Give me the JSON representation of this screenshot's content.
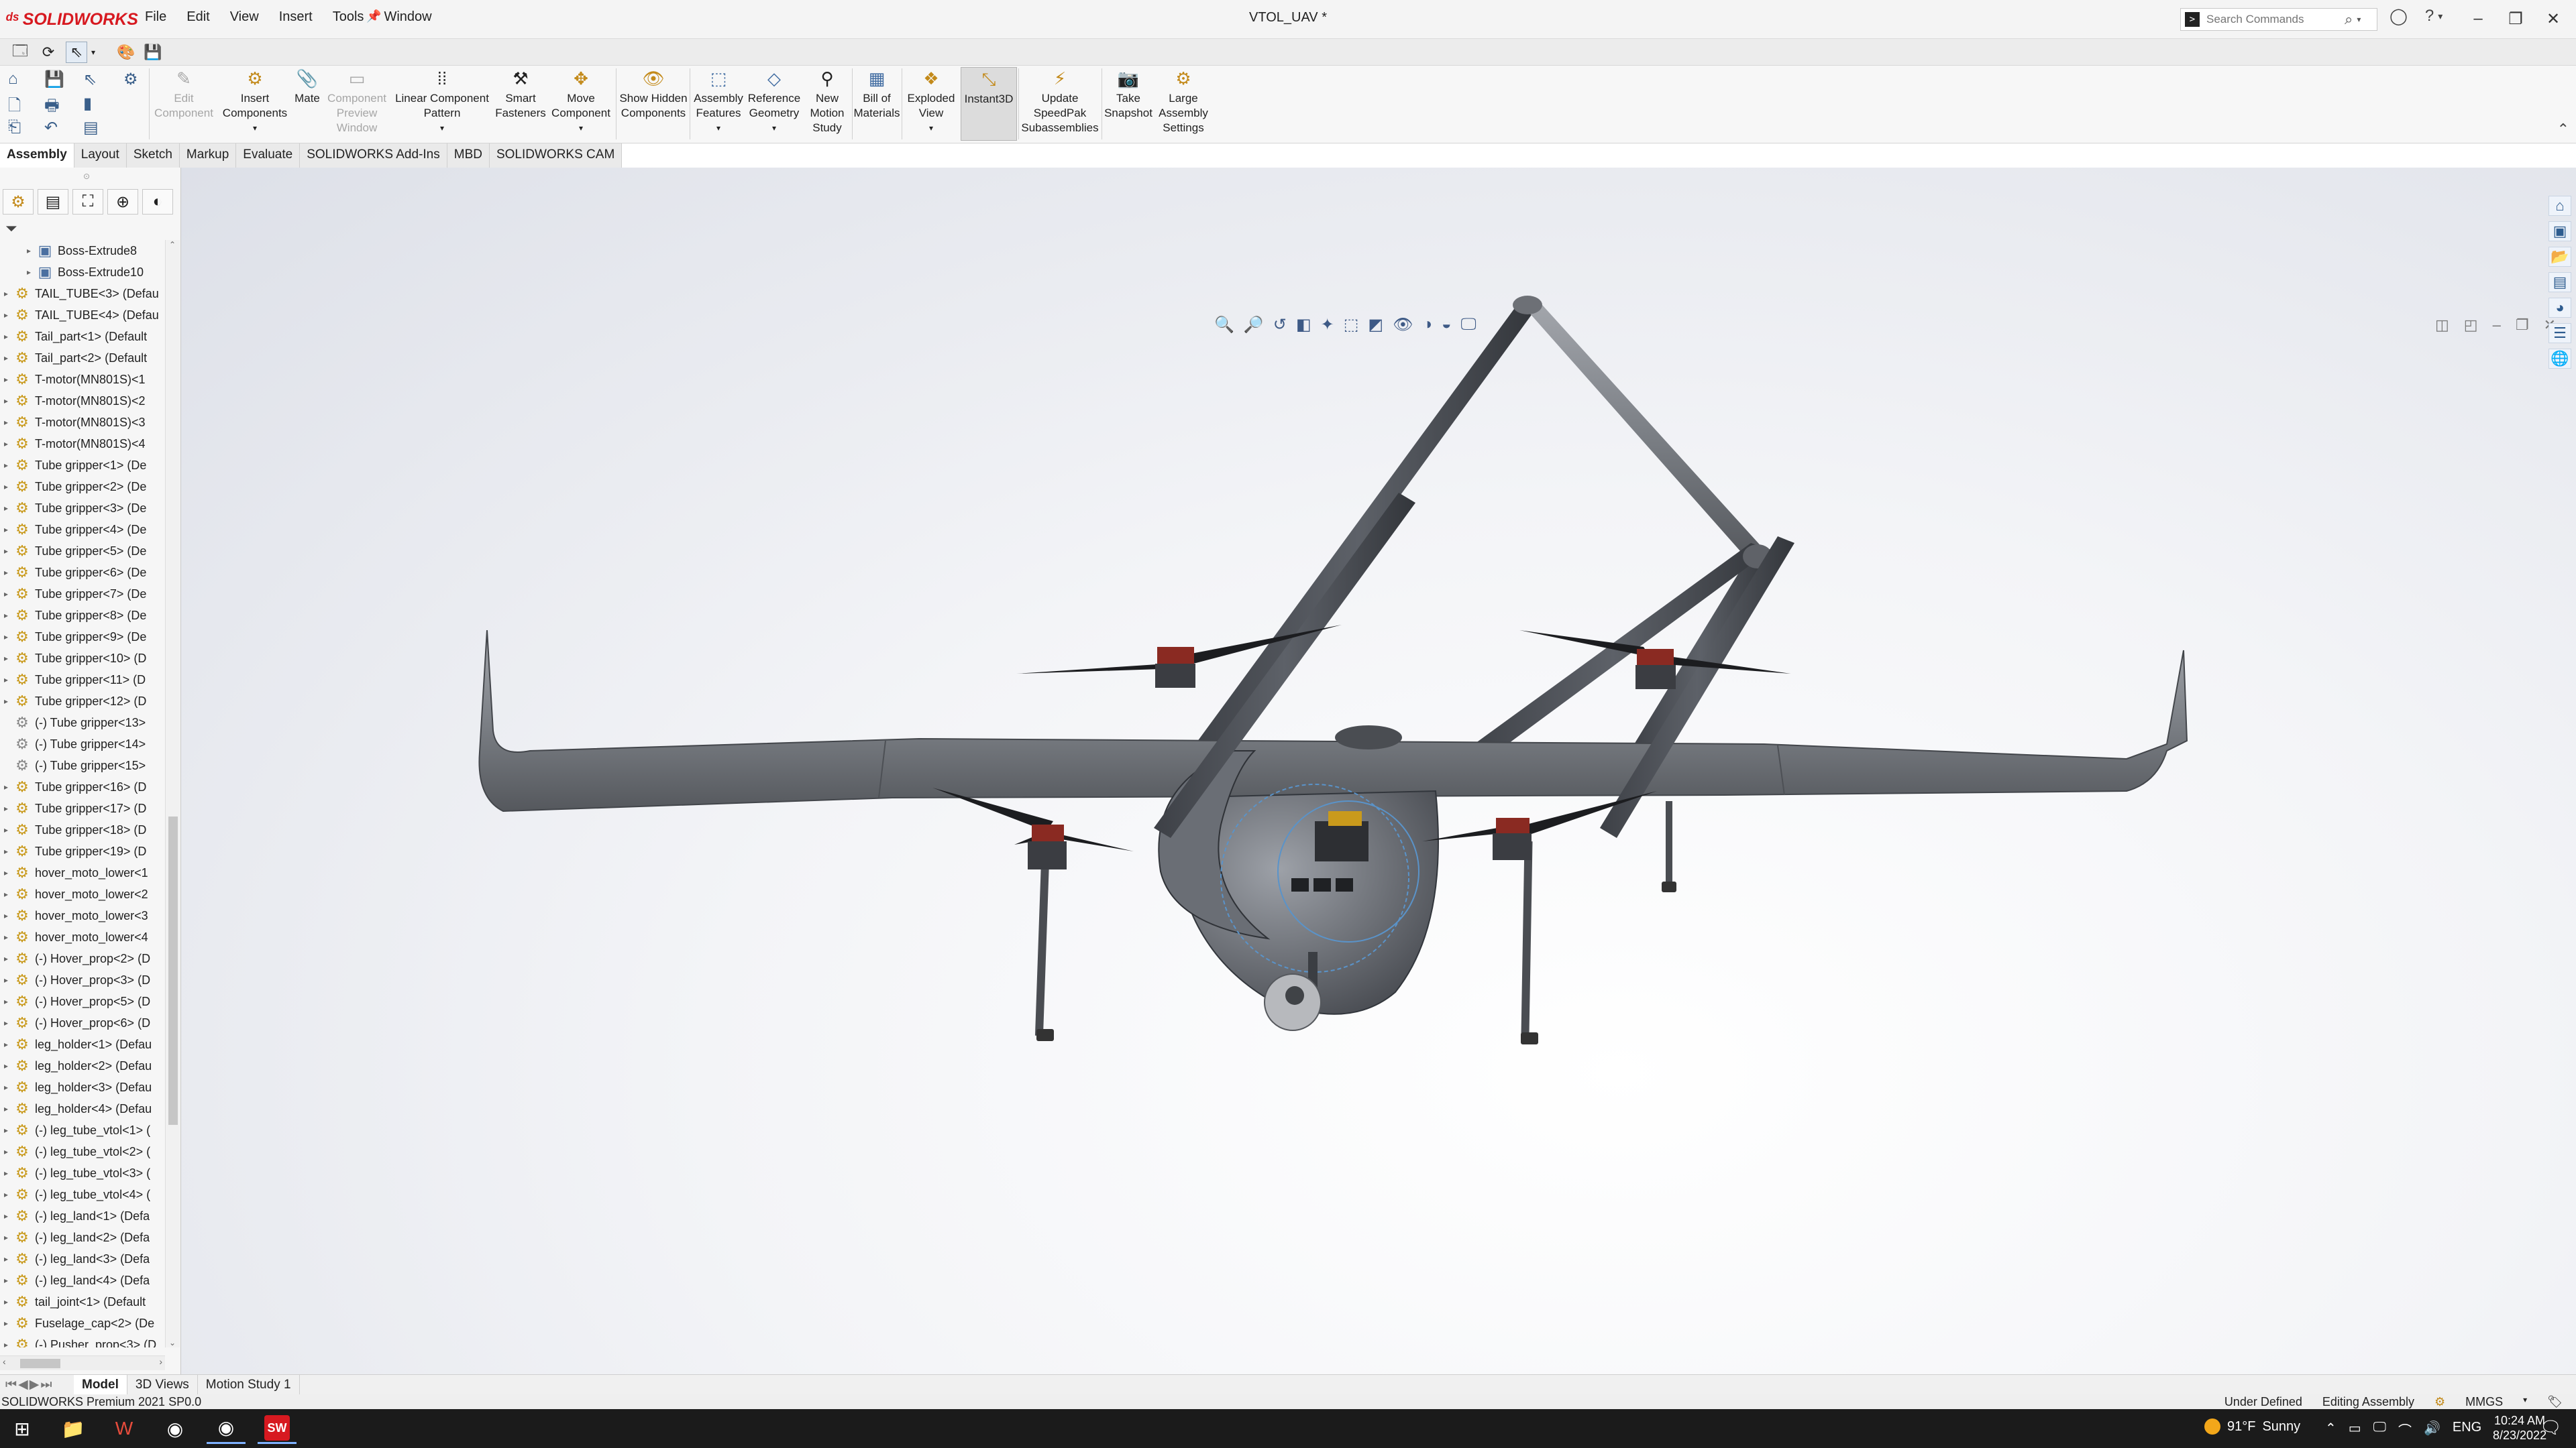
{
  "app": {
    "brand": "SOLIDWORKS",
    "document_title": "VTOL_UAV *",
    "menu": [
      "File",
      "Edit",
      "View",
      "Insert",
      "Tools",
      "Window"
    ],
    "search_placeholder": "Search Commands"
  },
  "ribbon": {
    "commands": [
      {
        "label": "Edit Component",
        "icon": "edit-component-icon",
        "enabled": false
      },
      {
        "label": "Insert Components",
        "icon": "insert-components-icon",
        "enabled": true
      },
      {
        "label": "Mate",
        "icon": "mate-icon",
        "enabled": true
      },
      {
        "label": "Component Preview Window",
        "icon": "preview-window-icon",
        "enabled": false
      },
      {
        "label": "Linear Component Pattern",
        "icon": "linear-pattern-icon",
        "enabled": true
      },
      {
        "label": "Smart Fasteners",
        "icon": "smart-fasteners-icon",
        "enabled": true
      },
      {
        "label": "Move Component",
        "icon": "move-component-icon",
        "enabled": true
      },
      {
        "label": "Show Hidden Components",
        "icon": "show-hidden-icon",
        "enabled": true
      },
      {
        "label": "Assembly Features",
        "icon": "assembly-features-icon",
        "enabled": true
      },
      {
        "label": "Reference Geometry",
        "icon": "reference-geometry-icon",
        "enabled": true
      },
      {
        "label": "New Motion Study",
        "icon": "motion-study-icon",
        "enabled": true
      },
      {
        "label": "Bill of Materials",
        "icon": "bom-icon",
        "enabled": true
      },
      {
        "label": "Exploded View",
        "icon": "exploded-view-icon",
        "enabled": true
      },
      {
        "label": "Instant3D",
        "icon": "instant3d-icon",
        "enabled": true,
        "active": true
      },
      {
        "label": "Update SpeedPak Subassemblies",
        "icon": "speedpak-icon",
        "enabled": true
      },
      {
        "label": "Take Snapshot",
        "icon": "snapshot-icon",
        "enabled": true
      },
      {
        "label": "Large Assembly Settings",
        "icon": "large-assembly-icon",
        "enabled": true
      }
    ],
    "tabs": [
      "Assembly",
      "Layout",
      "Sketch",
      "Markup",
      "Evaluate",
      "SOLIDWORKS Add-Ins",
      "MBD",
      "SOLIDWORKS CAM"
    ],
    "active_tab": "Assembly"
  },
  "tree": {
    "items": [
      {
        "label": "Boss-Extrude8",
        "type": "feature"
      },
      {
        "label": "Boss-Extrude10",
        "type": "feature"
      },
      {
        "label": "TAIL_TUBE<3> (Defau",
        "type": "part"
      },
      {
        "label": "TAIL_TUBE<4> (Defau",
        "type": "part"
      },
      {
        "label": "Tail_part<1> (Default",
        "type": "part"
      },
      {
        "label": "Tail_part<2> (Default",
        "type": "part"
      },
      {
        "label": "T-motor(MN801S)<1",
        "type": "part"
      },
      {
        "label": "T-motor(MN801S)<2",
        "type": "part"
      },
      {
        "label": "T-motor(MN801S)<3",
        "type": "part"
      },
      {
        "label": "T-motor(MN801S)<4",
        "type": "part"
      },
      {
        "label": "Tube gripper<1> (De",
        "type": "part"
      },
      {
        "label": "Tube gripper<2> (De",
        "type": "part"
      },
      {
        "label": "Tube gripper<3> (De",
        "type": "part"
      },
      {
        "label": "Tube gripper<4> (De",
        "type": "part"
      },
      {
        "label": "Tube gripper<5> (De",
        "type": "part"
      },
      {
        "label": "Tube gripper<6> (De",
        "type": "part"
      },
      {
        "label": "Tube gripper<7> (De",
        "type": "part"
      },
      {
        "label": "Tube gripper<8> (De",
        "type": "part"
      },
      {
        "label": "Tube gripper<9> (De",
        "type": "part"
      },
      {
        "label": "Tube gripper<10> (D",
        "type": "part"
      },
      {
        "label": "Tube gripper<11> (D",
        "type": "part"
      },
      {
        "label": "Tube gripper<12> (D",
        "type": "part"
      },
      {
        "label": "(-) Tube gripper<13>",
        "type": "hidden"
      },
      {
        "label": "(-) Tube gripper<14>",
        "type": "hidden"
      },
      {
        "label": "(-) Tube gripper<15>",
        "type": "hidden"
      },
      {
        "label": "Tube gripper<16> (D",
        "type": "part"
      },
      {
        "label": "Tube gripper<17> (D",
        "type": "part"
      },
      {
        "label": "Tube gripper<18> (D",
        "type": "part"
      },
      {
        "label": "Tube gripper<19> (D",
        "type": "part"
      },
      {
        "label": "hover_moto_lower<1",
        "type": "part"
      },
      {
        "label": "hover_moto_lower<2",
        "type": "part"
      },
      {
        "label": "hover_moto_lower<3",
        "type": "part"
      },
      {
        "label": "hover_moto_lower<4",
        "type": "part"
      },
      {
        "label": "(-) Hover_prop<2> (D",
        "type": "part"
      },
      {
        "label": "(-) Hover_prop<3> (D",
        "type": "part"
      },
      {
        "label": "(-) Hover_prop<5> (D",
        "type": "part"
      },
      {
        "label": "(-) Hover_prop<6> (D",
        "type": "part"
      },
      {
        "label": "leg_holder<1> (Defau",
        "type": "part"
      },
      {
        "label": "leg_holder<2> (Defau",
        "type": "part"
      },
      {
        "label": "leg_holder<3> (Defau",
        "type": "part"
      },
      {
        "label": "leg_holder<4> (Defau",
        "type": "part"
      },
      {
        "label": "(-) leg_tube_vtol<1> (",
        "type": "part"
      },
      {
        "label": "(-) leg_tube_vtol<2> (",
        "type": "part"
      },
      {
        "label": "(-) leg_tube_vtol<3> (",
        "type": "part"
      },
      {
        "label": "(-) leg_tube_vtol<4> (",
        "type": "part"
      },
      {
        "label": "(-) leg_land<1> (Defa",
        "type": "part"
      },
      {
        "label": "(-) leg_land<2> (Defa",
        "type": "part"
      },
      {
        "label": "(-) leg_land<3> (Defa",
        "type": "part"
      },
      {
        "label": "(-) leg_land<4> (Defa",
        "type": "part"
      },
      {
        "label": "tail_joint<1> (Default",
        "type": "part"
      },
      {
        "label": "Fuselage_cap<2> (De",
        "type": "part"
      },
      {
        "label": "(-) Pusher_prop<3> (D",
        "type": "part"
      }
    ]
  },
  "bottom_tabs": [
    "Model",
    "3D Views",
    "Motion Study 1"
  ],
  "active_bottom_tab": "Model",
  "status": {
    "version": "SOLIDWORKS Premium 2021 SP0.0",
    "definition": "Under Defined",
    "mode": "Editing Assembly",
    "units": "MMGS"
  },
  "taskbar": {
    "weather_temp": "91°F",
    "weather_desc": "Sunny",
    "language": "ENG",
    "time": "10:24 AM",
    "date": "8/23/2022",
    "solidworks_label": "SW"
  },
  "colors": {
    "brand_red": "#d71920",
    "part_gold": "#c99a1c",
    "airframe_gray": "#75787d"
  }
}
